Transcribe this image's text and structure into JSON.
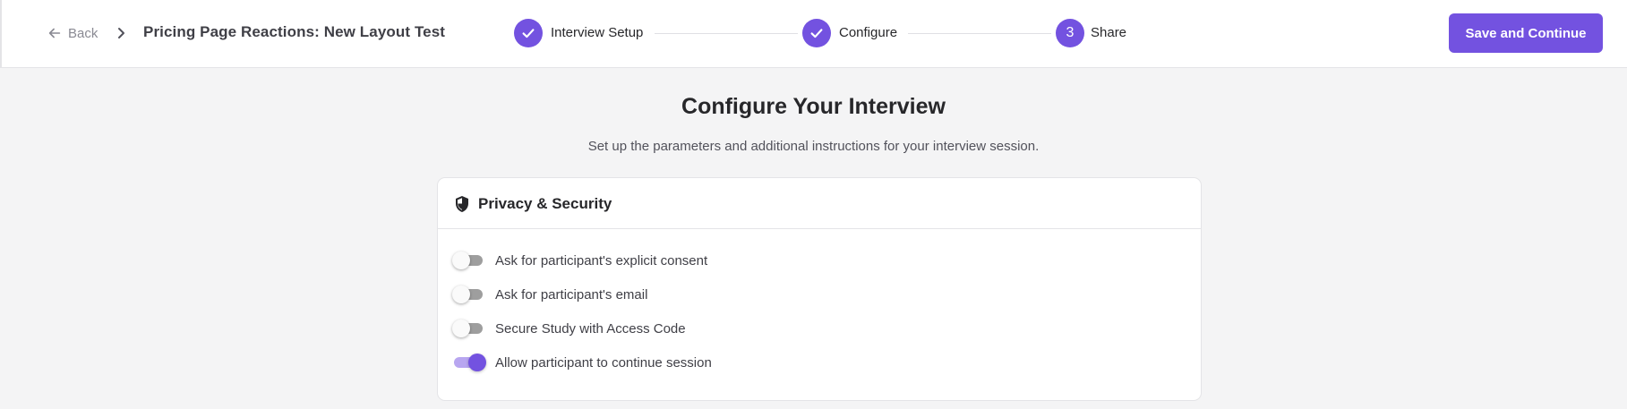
{
  "header": {
    "back_label": "Back",
    "title": "Pricing Page Reactions: New Layout Test",
    "steps": [
      {
        "label": "Interview Setup",
        "state": "done"
      },
      {
        "label": "Configure",
        "state": "done"
      },
      {
        "number": "3",
        "label": "Share",
        "state": "current"
      }
    ],
    "save_label": "Save and Continue"
  },
  "main": {
    "title": "Configure Your Interview",
    "subtitle": "Set up the parameters and additional instructions for your interview session."
  },
  "privacy": {
    "title": "Privacy & Security",
    "options": [
      {
        "label": "Ask for participant's explicit consent",
        "enabled": false
      },
      {
        "label": "Ask for participant's email",
        "enabled": false
      },
      {
        "label": "Secure Study with Access Code",
        "enabled": false
      },
      {
        "label": "Allow participant to continue session",
        "enabled": true
      }
    ]
  },
  "colors": {
    "accent": "#7352e0",
    "toggle_on_track": "#b8a6f0",
    "toggle_off_track": "#9e9e9e",
    "background": "#f4f4f5"
  },
  "icons": {
    "back": "arrow-left-icon",
    "breadcrumb": "chevron-right-icon",
    "step_done": "check-icon",
    "section": "shield-icon"
  }
}
